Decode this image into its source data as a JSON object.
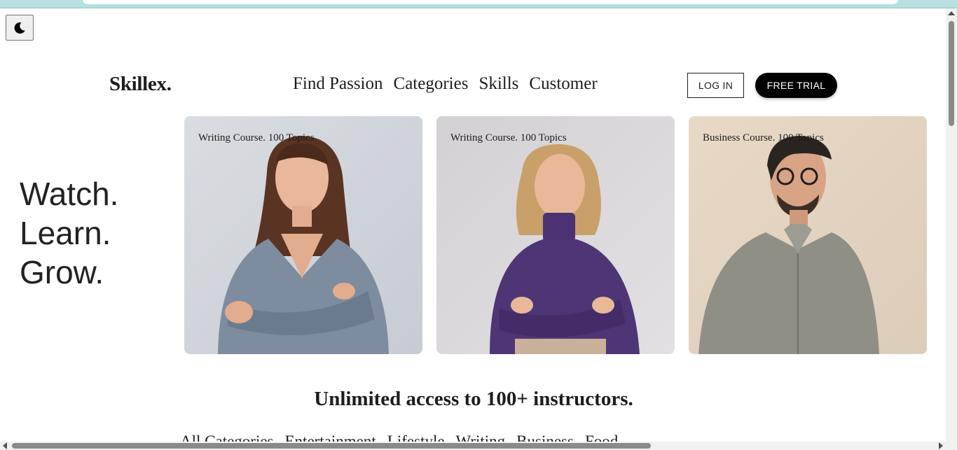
{
  "brand": {
    "logo": "Skillex."
  },
  "nav": {
    "items": [
      "Find Passion",
      "Categories",
      "Skills",
      "Customer"
    ]
  },
  "auth": {
    "login_label": "LOG IN",
    "trial_label": "FREE TRIAL"
  },
  "theme_toggle": {
    "icon": "moon-icon"
  },
  "hero": {
    "line1": "Watch.",
    "line2": "Learn.",
    "line3": "Grow."
  },
  "courses": [
    {
      "label": "Writing Course. 100 Topics",
      "image": "woman-grey-sweater-photo"
    },
    {
      "label": "Writing Course. 100 Topics",
      "image": "woman-purple-sweater-photo"
    },
    {
      "label": "Business Course. 100 Topics",
      "image": "man-glasses-photo"
    }
  ],
  "section": {
    "headline": "Unlimited access to 100+ instructors."
  },
  "categories": [
    "All Categories",
    "Entertainment",
    "Lifestyle",
    "Writing",
    "Business",
    "Food"
  ],
  "colors": {
    "accent": "#000000",
    "browser_strip": "#b5dfe0",
    "background": "#ffffff"
  }
}
